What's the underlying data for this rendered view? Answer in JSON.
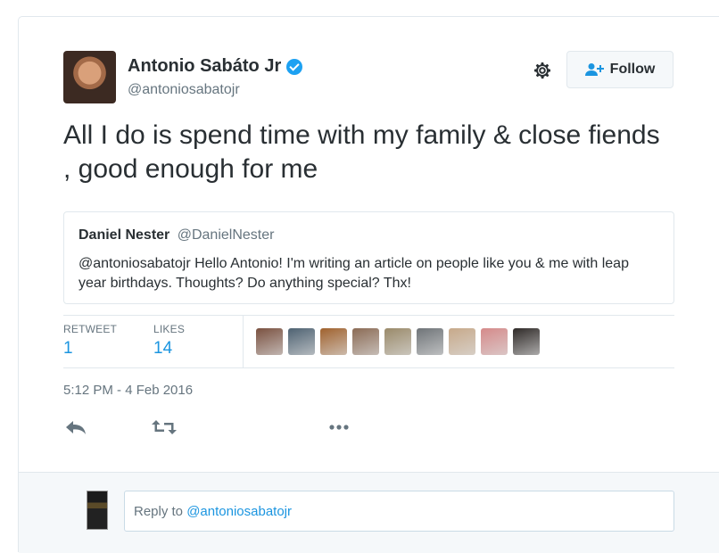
{
  "author": {
    "name": "Antonio Sabáto Jr",
    "handle": "@antoniosabatojr",
    "verified": true
  },
  "header": {
    "follow_label": "Follow"
  },
  "tweet": {
    "text": "All I do is spend time with my family & close fiends , good enough for me"
  },
  "quoted_tweet": {
    "name": "Daniel Nester",
    "handle": "@DanielNester",
    "text": "@antoniosabatojr Hello Antonio! I'm writing an article on people like you & me with leap year birthdays. Thoughts? Do anything special? Thx!"
  },
  "stats": {
    "retweets_label": "RETWEET",
    "retweets_value": "1",
    "likes_label": "LIKES",
    "likes_value": "14"
  },
  "likers": [
    {
      "name": "liker-avatar-1",
      "color": "#7a5140"
    },
    {
      "name": "liker-avatar-2",
      "color": "#4e6272"
    },
    {
      "name": "liker-avatar-3",
      "color": "#a0622e"
    },
    {
      "name": "liker-avatar-4",
      "color": "#8b6b55"
    },
    {
      "name": "liker-avatar-5",
      "color": "#9a8a6a"
    },
    {
      "name": "liker-avatar-6",
      "color": "#6f7478"
    },
    {
      "name": "liker-avatar-7",
      "color": "#c7a98a"
    },
    {
      "name": "liker-avatar-8",
      "color": "#d58a8a"
    },
    {
      "name": "liker-avatar-9",
      "color": "#2f2a28"
    }
  ],
  "timestamp": "5:12 PM - 4 Feb 2016",
  "actions": {
    "reply_icon": "reply-icon",
    "retweet_icon": "retweet-icon",
    "more_icon": "more-icon"
  },
  "reply": {
    "prefix": "Reply to ",
    "mention": "@antoniosabatojr"
  },
  "colors": {
    "accent": "#1b95e0",
    "verified": "#1da1f2",
    "muted_text": "#66757f",
    "border": "#e1e8ed"
  }
}
